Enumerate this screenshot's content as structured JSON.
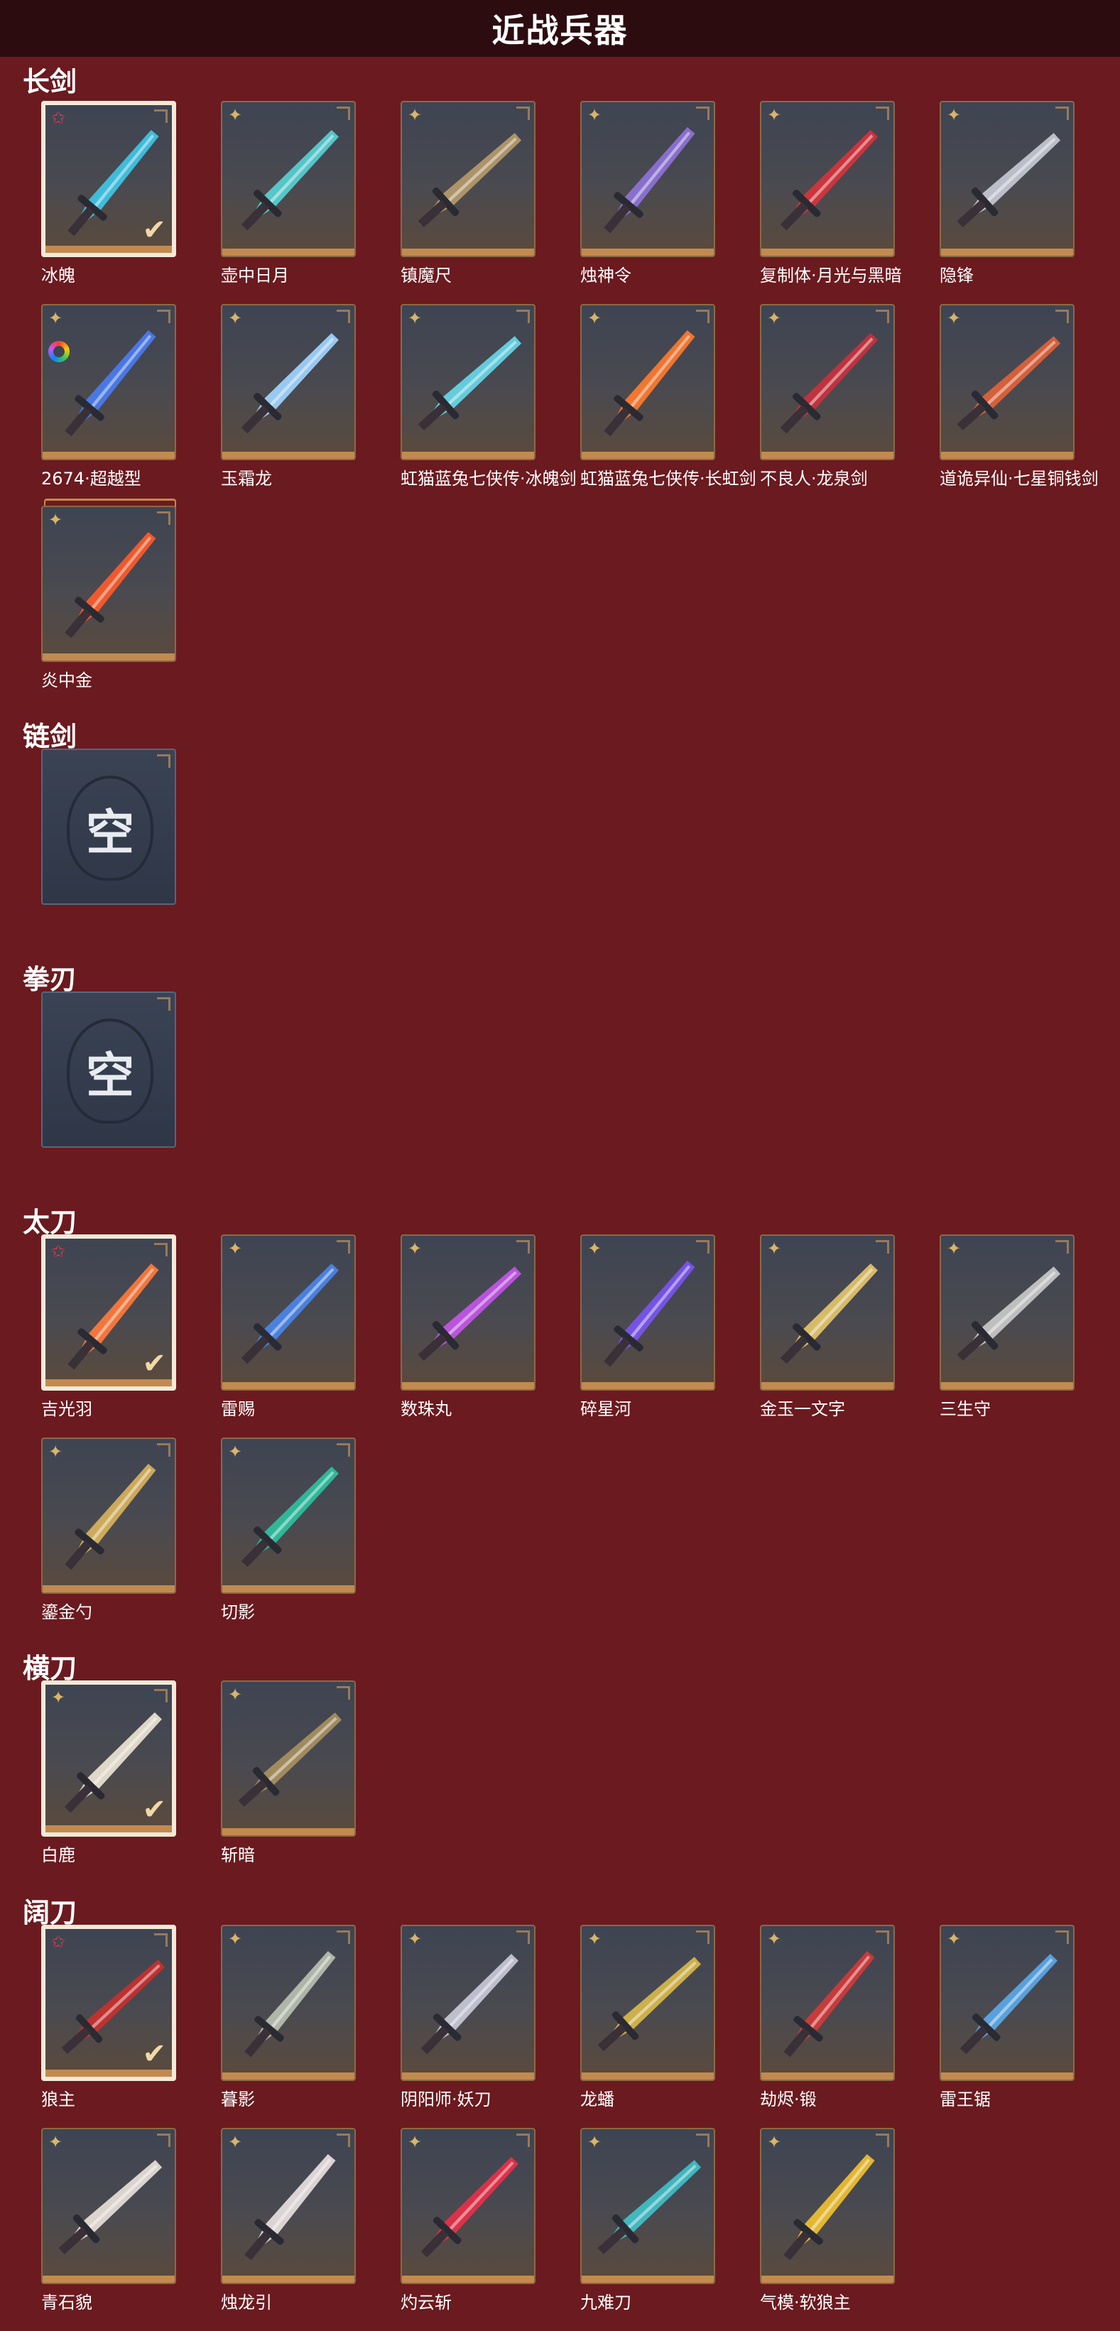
{
  "header": {
    "title": "近战兵器"
  },
  "icons": {
    "star_red": "star-red-icon",
    "star_gold": "star-gold-icon",
    "check": "check-icon",
    "corner": "corner-bracket-icon",
    "empty": "empty-slot-emblem-icon"
  },
  "colors": {
    "background": "#6b1a1f",
    "header": "#2d0c10",
    "gold": "#c28a4e",
    "star_red": "#e0394a",
    "star_gold": "#d9b46a"
  },
  "categories": [
    {
      "label": "长剑",
      "items": [
        {
          "name": "冰魄",
          "star": "red",
          "selected": true,
          "color": "#3fc6e6"
        },
        {
          "name": "壶中日月",
          "star": "gold",
          "color": "#57d0d3"
        },
        {
          "name": "镇魔尺",
          "star": "gold",
          "color": "#b59a6a"
        },
        {
          "name": "烛神令",
          "star": "gold",
          "color": "#8e72d8"
        },
        {
          "name": "复制体·月光与黑暗",
          "star": "gold",
          "color": "#d7333c"
        },
        {
          "name": "隐锋",
          "star": "gold",
          "color": "#c5c9d4"
        },
        {
          "name": "2674·超越型",
          "star": "gold",
          "ring": true,
          "color": "#4a7cf0"
        },
        {
          "name": "玉霜龙",
          "star": "gold",
          "color": "#9fd4ff"
        },
        {
          "name": "虹猫蓝兔七侠传·冰魄剑",
          "star": "gold",
          "color": "#66d7e8"
        },
        {
          "name": "虹猫蓝兔七侠传·长虹剑",
          "star": "gold",
          "color": "#ff7a2e"
        },
        {
          "name": "不良人·龙泉剑",
          "star": "gold",
          "color": "#c9313d"
        },
        {
          "name": "道诡异仙·七星铜钱剑",
          "star": "gold",
          "color": "#e0623a"
        },
        {
          "name": "炎中金",
          "star": "gold",
          "stack": true,
          "color": "#ff5a2a"
        }
      ]
    },
    {
      "label": "链剑",
      "empty_text": "空",
      "items": []
    },
    {
      "label": "拳刃",
      "empty_text": "空",
      "items": []
    },
    {
      "label": "太刀",
      "items": [
        {
          "name": "吉光羽",
          "star": "red",
          "selected": true,
          "color": "#ff7a3a"
        },
        {
          "name": "雷赐",
          "star": "gold",
          "color": "#4a86e8"
        },
        {
          "name": "数珠丸",
          "star": "gold",
          "color": "#c355e8"
        },
        {
          "name": "碎星河",
          "star": "gold",
          "color": "#7a55f0"
        },
        {
          "name": "金玉一文字",
          "star": "gold",
          "color": "#e3c46a"
        },
        {
          "name": "三生守",
          "star": "gold",
          "color": "#c9c9c9"
        },
        {
          "name": "鎏金勺",
          "star": "gold",
          "color": "#d8b25c"
        },
        {
          "name": "切影",
          "star": "gold",
          "color": "#2ec0a0"
        }
      ]
    },
    {
      "label": "横刀",
      "items": [
        {
          "name": "白鹿",
          "star": "gold",
          "selected": true,
          "color": "#ece4d2"
        },
        {
          "name": "斩暗",
          "star": "gold",
          "color": "#a89060"
        }
      ]
    },
    {
      "label": "阔刀",
      "items": [
        {
          "name": "狼主",
          "star": "red",
          "selected": true,
          "color": "#c8302e"
        },
        {
          "name": "暮影",
          "star": "gold",
          "color": "#b8c0b0"
        },
        {
          "name": "阴阳师·妖刀",
          "star": "gold",
          "color": "#c8c8d8"
        },
        {
          "name": "龙蟠",
          "star": "gold",
          "color": "#d8b84a"
        },
        {
          "name": "劫烬·锻",
          "star": "gold",
          "color": "#d23a3a"
        },
        {
          "name": "雷王锯",
          "star": "gold",
          "color": "#5aa8e8"
        },
        {
          "name": "青石貌",
          "star": "gold",
          "color": "#e8e0d8"
        },
        {
          "name": "烛龙引",
          "star": "gold",
          "color": "#e8e0e0"
        },
        {
          "name": "灼云斩",
          "star": "gold",
          "color": "#e83048"
        },
        {
          "name": "九难刀",
          "star": "gold",
          "color": "#40c0c8"
        },
        {
          "name": "气模·软狼主",
          "star": "gold",
          "color": "#f0c030"
        }
      ]
    }
  ]
}
